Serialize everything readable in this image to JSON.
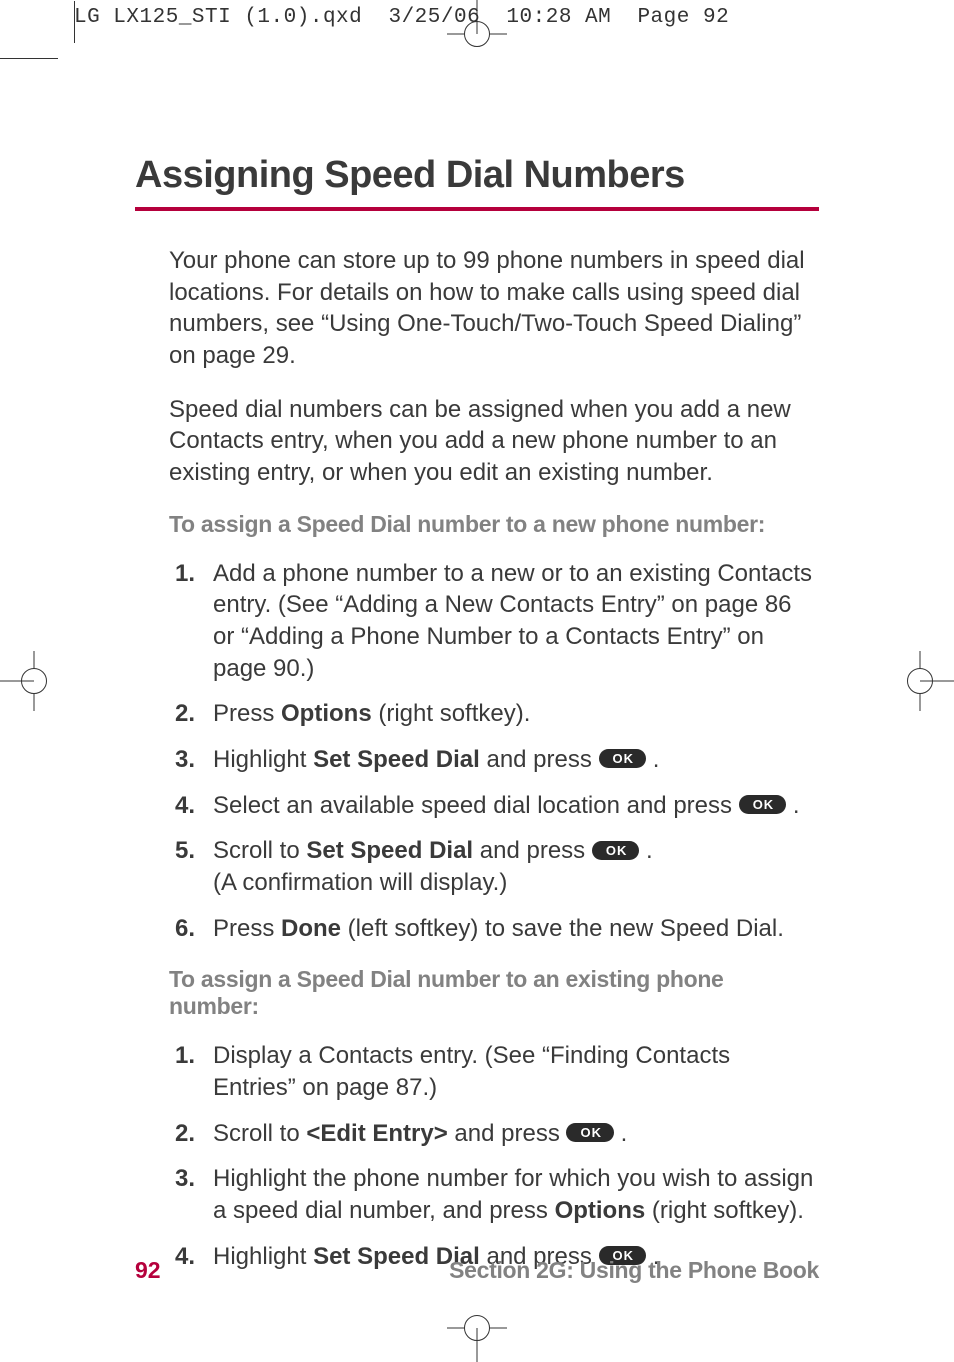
{
  "prepress": {
    "filename": "LG LX125_STI (1.0).qxd",
    "date": "3/25/06",
    "time": "10:28 AM",
    "pagetag": "Page 92"
  },
  "heading": "Assigning Speed Dial Numbers",
  "intro1": "Your phone can store up to 99 phone numbers in speed dial locations. For details on how to make calls using speed dial numbers, see “Using One-Touch/Two-Touch Speed Dialing” on page 29.",
  "intro2": "Speed dial numbers can be assigned when you add a new Contacts entry, when you add a new phone number to an existing entry, or when you edit an existing number.",
  "sub1": "To assign a Speed Dial number to a new phone number:",
  "s1": {
    "n1": "1.",
    "t1": "Add a phone number to a new or to an existing Contacts entry. (See “Adding a New Contacts Entry” on page 86 or “Adding a Phone Number to a Contacts Entry” on page 90.)",
    "n2": "2.",
    "t2_a": "Press ",
    "t2_b": "Options",
    "t2_c": " (right softkey).",
    "n3": "3.",
    "t3_a": "Highlight ",
    "t3_b": "Set Speed Dial",
    "t3_c": " and press ",
    "t3_d": ".",
    "n4": "4.",
    "t4_a": "Select an available speed dial location and press ",
    "t4_b": ".",
    "n5": "5.",
    "t5_a": "Scroll to ",
    "t5_b": "Set Speed Dial",
    "t5_c": " and press ",
    "t5_d": ".",
    "t5_e": "(A confirmation will display.)",
    "n6": "6.",
    "t6_a": "Press ",
    "t6_b": "Done",
    "t6_c": " (left softkey) to save the new Speed Dial."
  },
  "sub2": "To assign a Speed Dial number to an existing phone number:",
  "s2": {
    "n1": "1.",
    "t1": "Display a Contacts entry. (See “Finding Contacts Entries” on page 87.)",
    "n2": "2.",
    "t2_a": "Scroll to ",
    "t2_b": "<Edit Entry>",
    "t2_c": " and press ",
    "t2_d": ".",
    "n3": "3.",
    "t3_a": "Highlight the phone number for which you wish to assign a speed dial number, and press ",
    "t3_b": "Options",
    "t3_c": " (right softkey).",
    "n4": "4.",
    "t4_a": "Highlight ",
    "t4_b": "Set Speed Dial",
    "t4_c": " and press ",
    "t4_d": "."
  },
  "ok_label": "OK",
  "footer": {
    "page": "92",
    "section": "Section 2G: Using the Phone Book"
  }
}
